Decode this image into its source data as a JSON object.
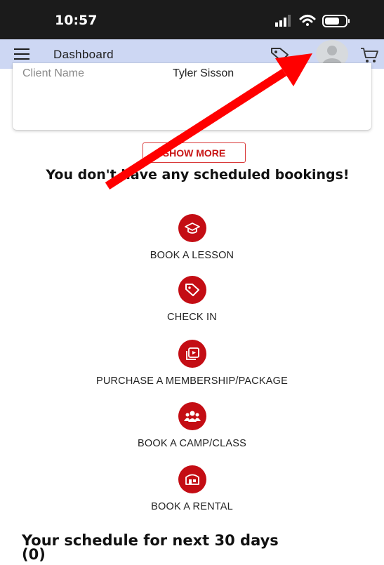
{
  "status_bar": {
    "time": "10:57"
  },
  "app_bar": {
    "title": "Dashboard"
  },
  "client": {
    "label": "Client Name",
    "value": "Tyler Sisson"
  },
  "show_more_label": "SHOW MORE",
  "empty_message": "You don't have any scheduled bookings!",
  "actions": [
    {
      "icon": "graduation-cap-icon",
      "label": "BOOK A LESSON"
    },
    {
      "icon": "tag-icon",
      "label": "CHECK IN"
    },
    {
      "icon": "membership-card-icon",
      "label": "PURCHASE A MEMBERSHIP/PACKAGE"
    },
    {
      "icon": "group-icon",
      "label": "BOOK A CAMP/CLASS"
    },
    {
      "icon": "building-icon",
      "label": "BOOK A RENTAL"
    }
  ],
  "schedule": {
    "title": "Your schedule for next 30 days",
    "count": "(0)"
  },
  "colors": {
    "accent": "#c40d14",
    "app_bar": "#cdd7f3",
    "status_bar": "#1b1b1b",
    "annotation_arrow": "#ff0000"
  }
}
